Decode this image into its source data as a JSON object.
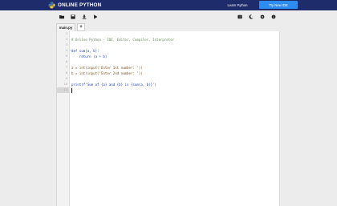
{
  "app": {
    "name": "ONLINE PYTHON",
    "learn_label": "Learn Python",
    "try_label": "Try New IDE",
    "accent": "#2d8cf0",
    "header_bg": "#1f2c6b"
  },
  "toolbar": {
    "left_icons": [
      "folder-open-icon",
      "save-icon",
      "download-icon",
      "play-icon"
    ],
    "right_icons": [
      "columns-icon",
      "dark-mode-icon",
      "settings-icon",
      "info-icon"
    ]
  },
  "tabs": {
    "file": "main.py",
    "add": "+"
  },
  "editor": {
    "line_numbers": [
      "1",
      "2",
      "3",
      "4",
      "5",
      "6",
      "7",
      "8",
      "9",
      "10",
      "11"
    ],
    "lines": [
      "",
      "# Online Python - IDE, Editor, Compiler, Interpreter",
      "",
      "def sum(a, b):",
      "    return (a + b)",
      "",
      "a = int(input('Enter 1st number: '))",
      "b = int(input('Enter 2nd number: '))",
      "",
      "print(f'Sum of {a} and {b} is {sum(a, b)}')",
      ""
    ],
    "fold_marker": "▾"
  }
}
